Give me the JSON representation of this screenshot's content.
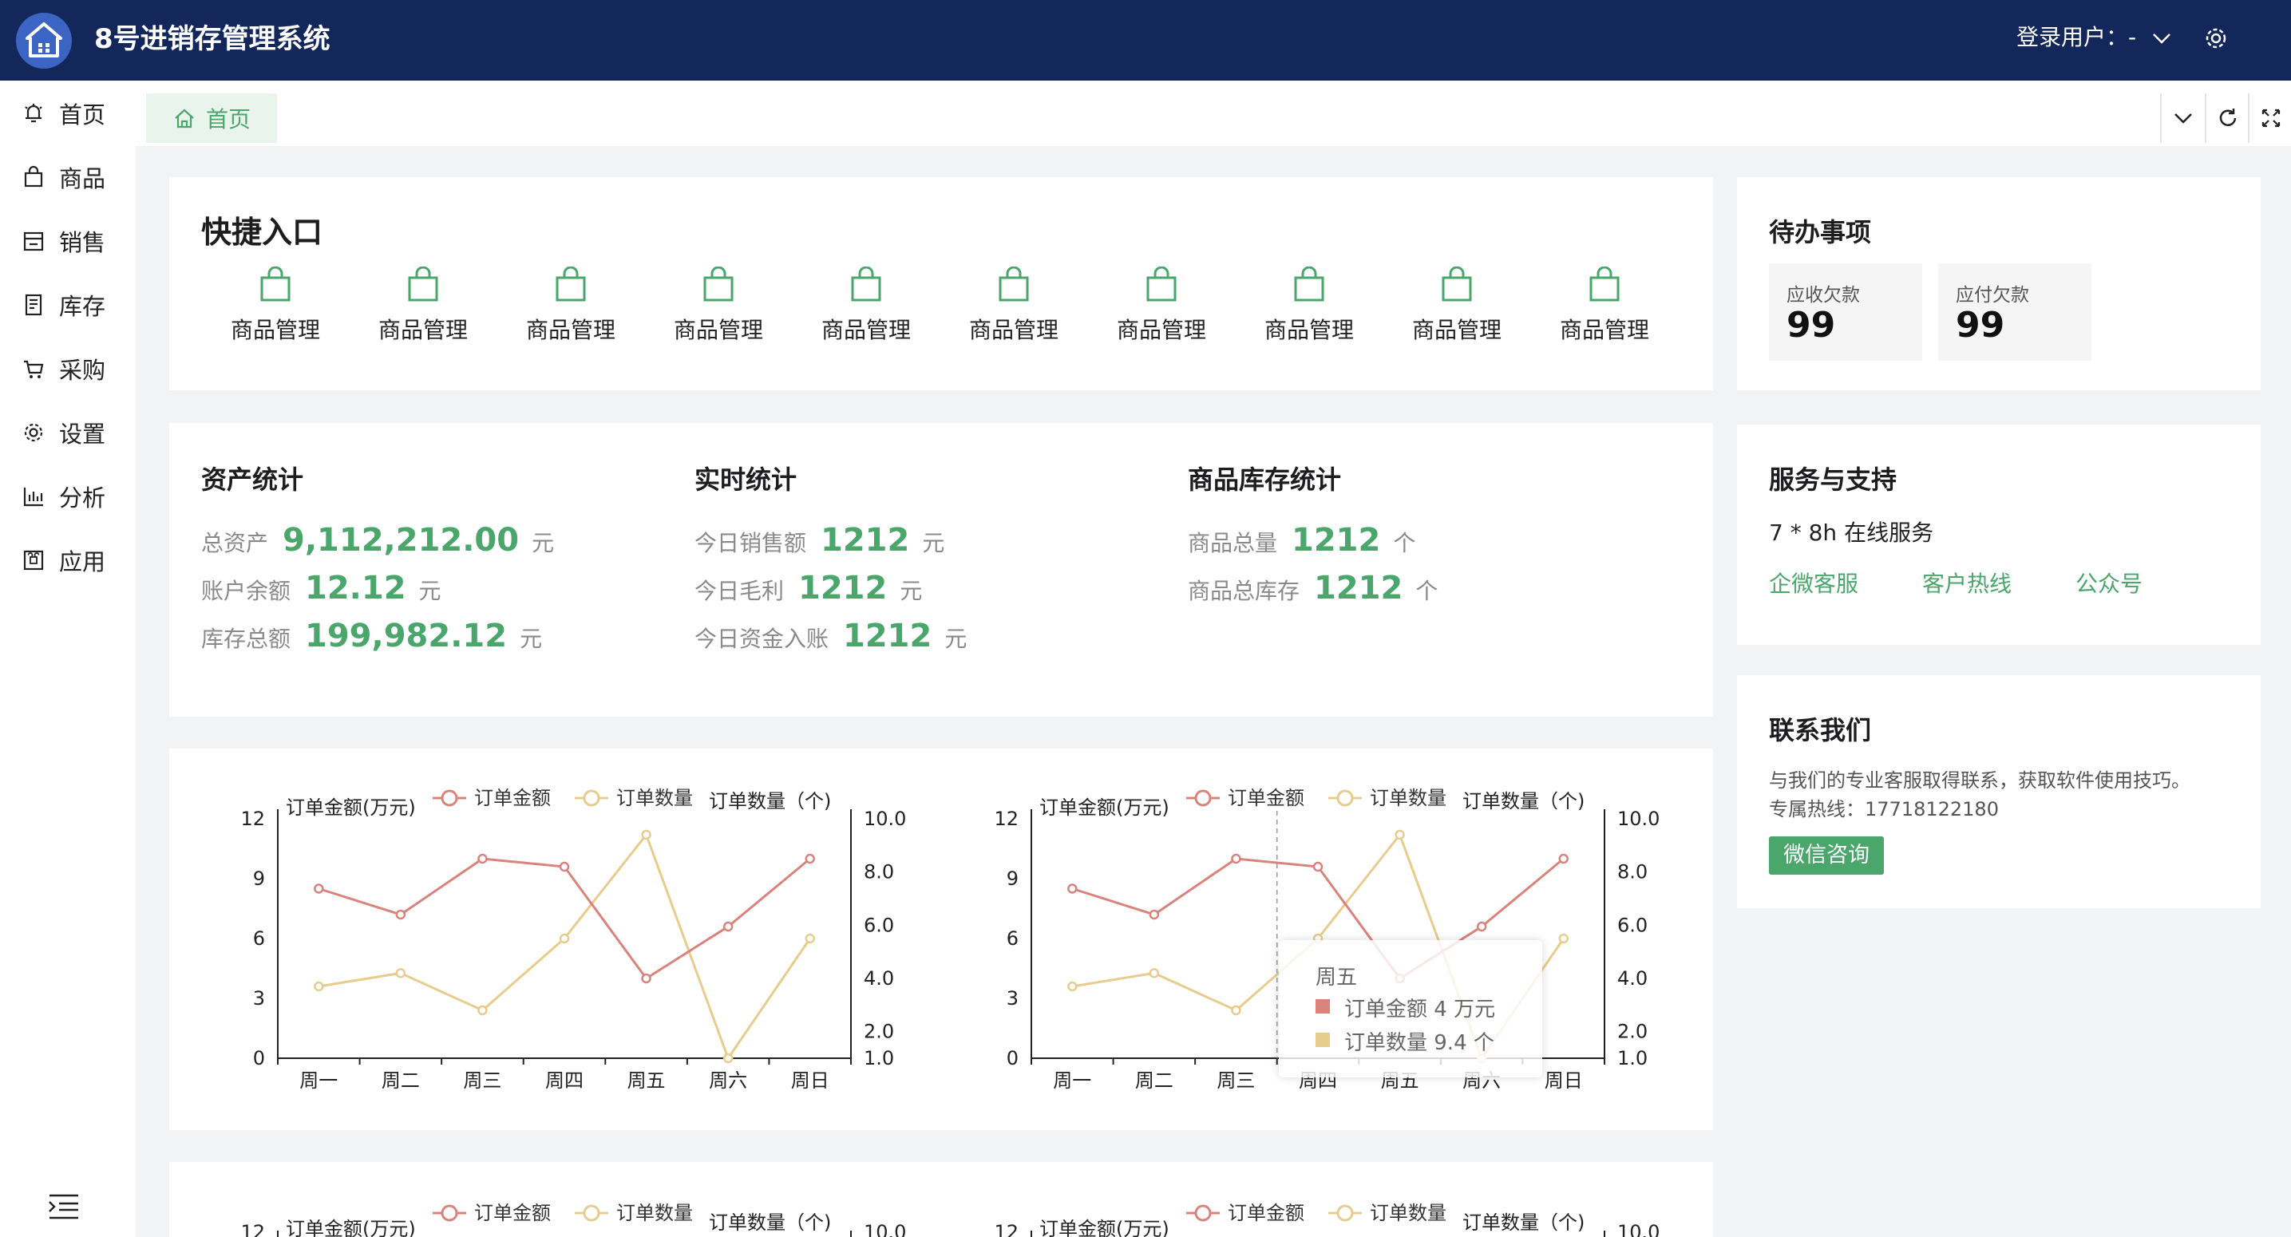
{
  "header": {
    "app_title": "8号进销存管理系统",
    "login_label": "登录用户：-",
    "icons": [
      "home-logo-icon",
      "chevron-down-icon",
      "gear-icon"
    ]
  },
  "sidebar": {
    "items": [
      {
        "label": "首页",
        "icon": "bell-icon"
      },
      {
        "label": "商品",
        "icon": "bag-icon"
      },
      {
        "label": "销售",
        "icon": "store-icon"
      },
      {
        "label": "库存",
        "icon": "document-icon"
      },
      {
        "label": "采购",
        "icon": "cart-icon"
      },
      {
        "label": "设置",
        "icon": "gear-icon"
      },
      {
        "label": "分析",
        "icon": "bar-chart-icon"
      },
      {
        "label": "应用",
        "icon": "command-icon"
      }
    ]
  },
  "tabs": {
    "home_label": "首页"
  },
  "quick_entry": {
    "title": "快捷入口",
    "items": [
      "商品管理",
      "商品管理",
      "商品管理",
      "商品管理",
      "商品管理",
      "商品管理",
      "商品管理",
      "商品管理",
      "商品管理",
      "商品管理"
    ]
  },
  "asset_stats": {
    "title": "资产统计",
    "rows": [
      {
        "label": "总资产",
        "value": "9,112,212.00",
        "unit": "元"
      },
      {
        "label": "账户余额",
        "value": "12.12",
        "unit": "元"
      },
      {
        "label": "库存总额",
        "value": "199,982.12",
        "unit": "元"
      }
    ]
  },
  "realtime_stats": {
    "title": "实时统计",
    "rows": [
      {
        "label": "今日销售额",
        "value": "1212",
        "unit": "元"
      },
      {
        "label": "今日毛利",
        "value": "1212",
        "unit": "元"
      },
      {
        "label": "今日资金入账",
        "value": "1212",
        "unit": "元"
      }
    ]
  },
  "stock_stats": {
    "title": "商品库存统计",
    "rows": [
      {
        "label": "商品总量",
        "value": "1212",
        "unit": "个"
      },
      {
        "label": "商品总库存",
        "value": "1212",
        "unit": "个"
      }
    ]
  },
  "todo": {
    "title": "待办事项",
    "boxes": [
      {
        "label": "应收欠款",
        "value": "99"
      },
      {
        "label": "应付欠款",
        "value": "99"
      }
    ]
  },
  "service": {
    "title": "服务与支持",
    "subtitle": "7 * 8h 在线服务",
    "links": [
      "企微客服",
      "客户热线",
      "公众号"
    ]
  },
  "contact": {
    "title": "联系我们",
    "line1": "与我们的专业客服取得联系，获取软件使用技巧。",
    "line2": "专属热线：17718122180",
    "button": "微信咨询"
  },
  "tooltip": {
    "day": "周五",
    "line1": "订单金额 4 万元",
    "line2": "订单数量 9.4 个"
  },
  "colors": {
    "primary": "#4aa66b",
    "header": "#13275a",
    "series_amount": "#d9837c",
    "series_count": "#e8cc8e"
  },
  "chart_data": [
    {
      "type": "line",
      "categories": [
        "周一",
        "周二",
        "周三",
        "周四",
        "周五",
        "周六",
        "周日"
      ],
      "series": [
        {
          "name": "订单金额",
          "axis": "left",
          "values": [
            8.5,
            7.2,
            10,
            9.6,
            4,
            6.6,
            10
          ]
        },
        {
          "name": "订单数量",
          "axis": "right",
          "values": [
            3.7,
            4.2,
            2.8,
            5.5,
            9.4,
            1,
            5.5
          ]
        }
      ],
      "ylabel": "订单金额(万元)",
      "y2label": "订单数量（个)",
      "ylim": [
        0,
        12
      ],
      "yticks": [
        "0",
        "3",
        "6",
        "9",
        "12"
      ],
      "y2lim": [
        1,
        10
      ],
      "y2ticks": [
        "1.0",
        "2.0",
        "4.0",
        "6.0",
        "8.0",
        "10.0"
      ],
      "legend": "top-center"
    },
    {
      "type": "line",
      "categories": [
        "周一",
        "周二",
        "周三",
        "周四",
        "周五",
        "周六",
        "周日"
      ],
      "series": [
        {
          "name": "订单金额",
          "axis": "left",
          "values": [
            8.5,
            7.2,
            10,
            9.6,
            4,
            6.6,
            10
          ]
        },
        {
          "name": "订单数量",
          "axis": "right",
          "values": [
            3.7,
            4.2,
            2.8,
            5.5,
            9.4,
            1,
            5.5
          ]
        }
      ],
      "ylabel": "订单金额(万元)",
      "y2label": "订单数量（个)",
      "ylim": [
        0,
        12
      ],
      "yticks": [
        "0",
        "3",
        "6",
        "9",
        "12"
      ],
      "y2lim": [
        1,
        10
      ],
      "y2ticks": [
        "1.0",
        "2.0",
        "4.0",
        "6.0",
        "8.0",
        "10.0"
      ],
      "legend": "top-center"
    },
    {
      "type": "line",
      "categories": [],
      "series": [
        {
          "name": "订单金额",
          "values": []
        },
        {
          "name": "订单数量",
          "values": []
        }
      ],
      "ylabel": "订单金额(万元)",
      "y2label": "订单数量（个)",
      "yticks": [
        "12"
      ],
      "y2ticks": [
        "10.0"
      ]
    },
    {
      "type": "line",
      "categories": [],
      "series": [
        {
          "name": "订单金额",
          "values": []
        },
        {
          "name": "订单数量",
          "values": []
        }
      ],
      "ylabel": "订单金额(万元)",
      "y2label": "订单数量（个)",
      "yticks": [
        "12"
      ],
      "y2ticks": [
        "10.0"
      ]
    }
  ]
}
